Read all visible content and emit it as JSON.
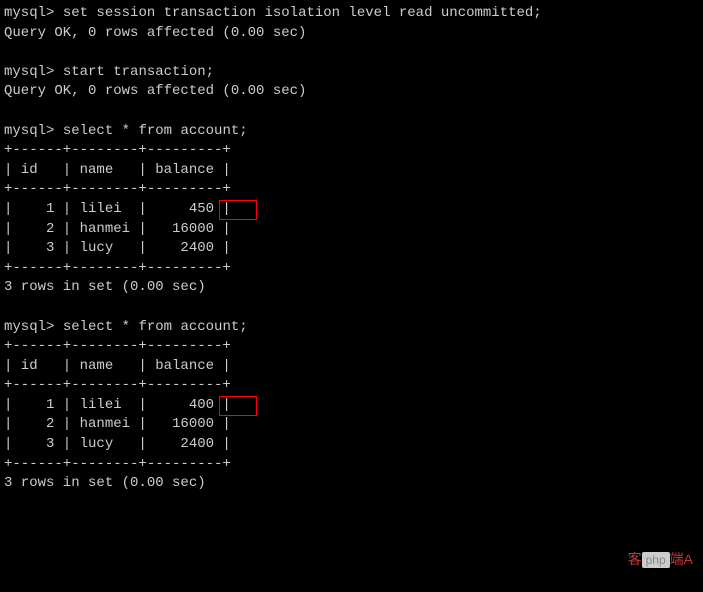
{
  "session1": {
    "prompt": "mysql>",
    "cmd1": "set session transaction isolation level read uncommitted;",
    "result1": "Query OK, 0 rows affected (0.00 sec)",
    "cmd2": "start transaction;",
    "result2": "Query OK, 0 rows affected (0.00 sec)"
  },
  "query1": {
    "prompt": "mysql>",
    "cmd": "select * from account;",
    "border_top": "+------+--------+---------+",
    "header_row": "| id   | name   | balance |",
    "border_mid": "+------+--------+---------+",
    "rows": [
      {
        "id": "1",
        "name": "lilei",
        "balance": "450",
        "highlight": true
      },
      {
        "id": "2",
        "name": "hanmei",
        "balance": "16000"
      },
      {
        "id": "3",
        "name": "lucy",
        "balance": "2400"
      }
    ],
    "border_bot": "+------+--------+---------+",
    "footer": "3 rows in set (0.00 sec)"
  },
  "query2": {
    "prompt": "mysql>",
    "cmd": "select * from account;",
    "border_top": "+------+--------+---------+",
    "header_row": "| id   | name   | balance |",
    "border_mid": "+------+--------+---------+",
    "rows": [
      {
        "id": "1",
        "name": "lilei",
        "balance": "400",
        "highlight": true
      },
      {
        "id": "2",
        "name": "hanmei",
        "balance": "16000"
      },
      {
        "id": "3",
        "name": "lucy",
        "balance": "2400"
      }
    ],
    "border_bot": "+------+--------+---------+",
    "footer": "3 rows in set (0.00 sec)"
  },
  "watermark": {
    "left": "客",
    "php": "php",
    "right": "端A"
  }
}
